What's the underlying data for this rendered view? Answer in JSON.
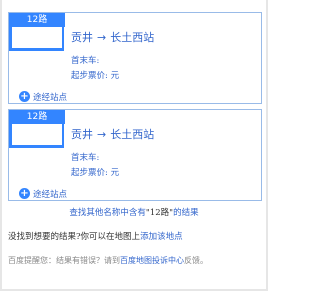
{
  "routes": [
    {
      "badge": "12路",
      "from": "贡井",
      "arrow": "→",
      "to": "长土西站",
      "first_last_label": "首末车:",
      "first_last_value": "",
      "fare_label": "起步票价:",
      "fare_value": "元",
      "stops_label": "途经站点"
    },
    {
      "badge": "12路",
      "from": "贡井",
      "arrow": "→",
      "to": "长土西站",
      "first_last_label": "首末车:",
      "first_last_value": "",
      "fare_label": "起步票价:",
      "fare_value": "元",
      "stops_label": "途经站点"
    }
  ],
  "more": {
    "prefix": "查找其他名称中含有",
    "query": "\"12路\"",
    "suffix": "的结果"
  },
  "no_result": {
    "text": "没找到想要的结果?你可以在地图上",
    "link": "添加该地点"
  },
  "reminder": {
    "text": "百度提醒您：结果有错误？请到",
    "link": "百度地图投诉中心",
    "suffix": "反馈。"
  },
  "colors": {
    "accent": "#3385ff",
    "link": "#3366cc",
    "border": "#99bbe8"
  }
}
